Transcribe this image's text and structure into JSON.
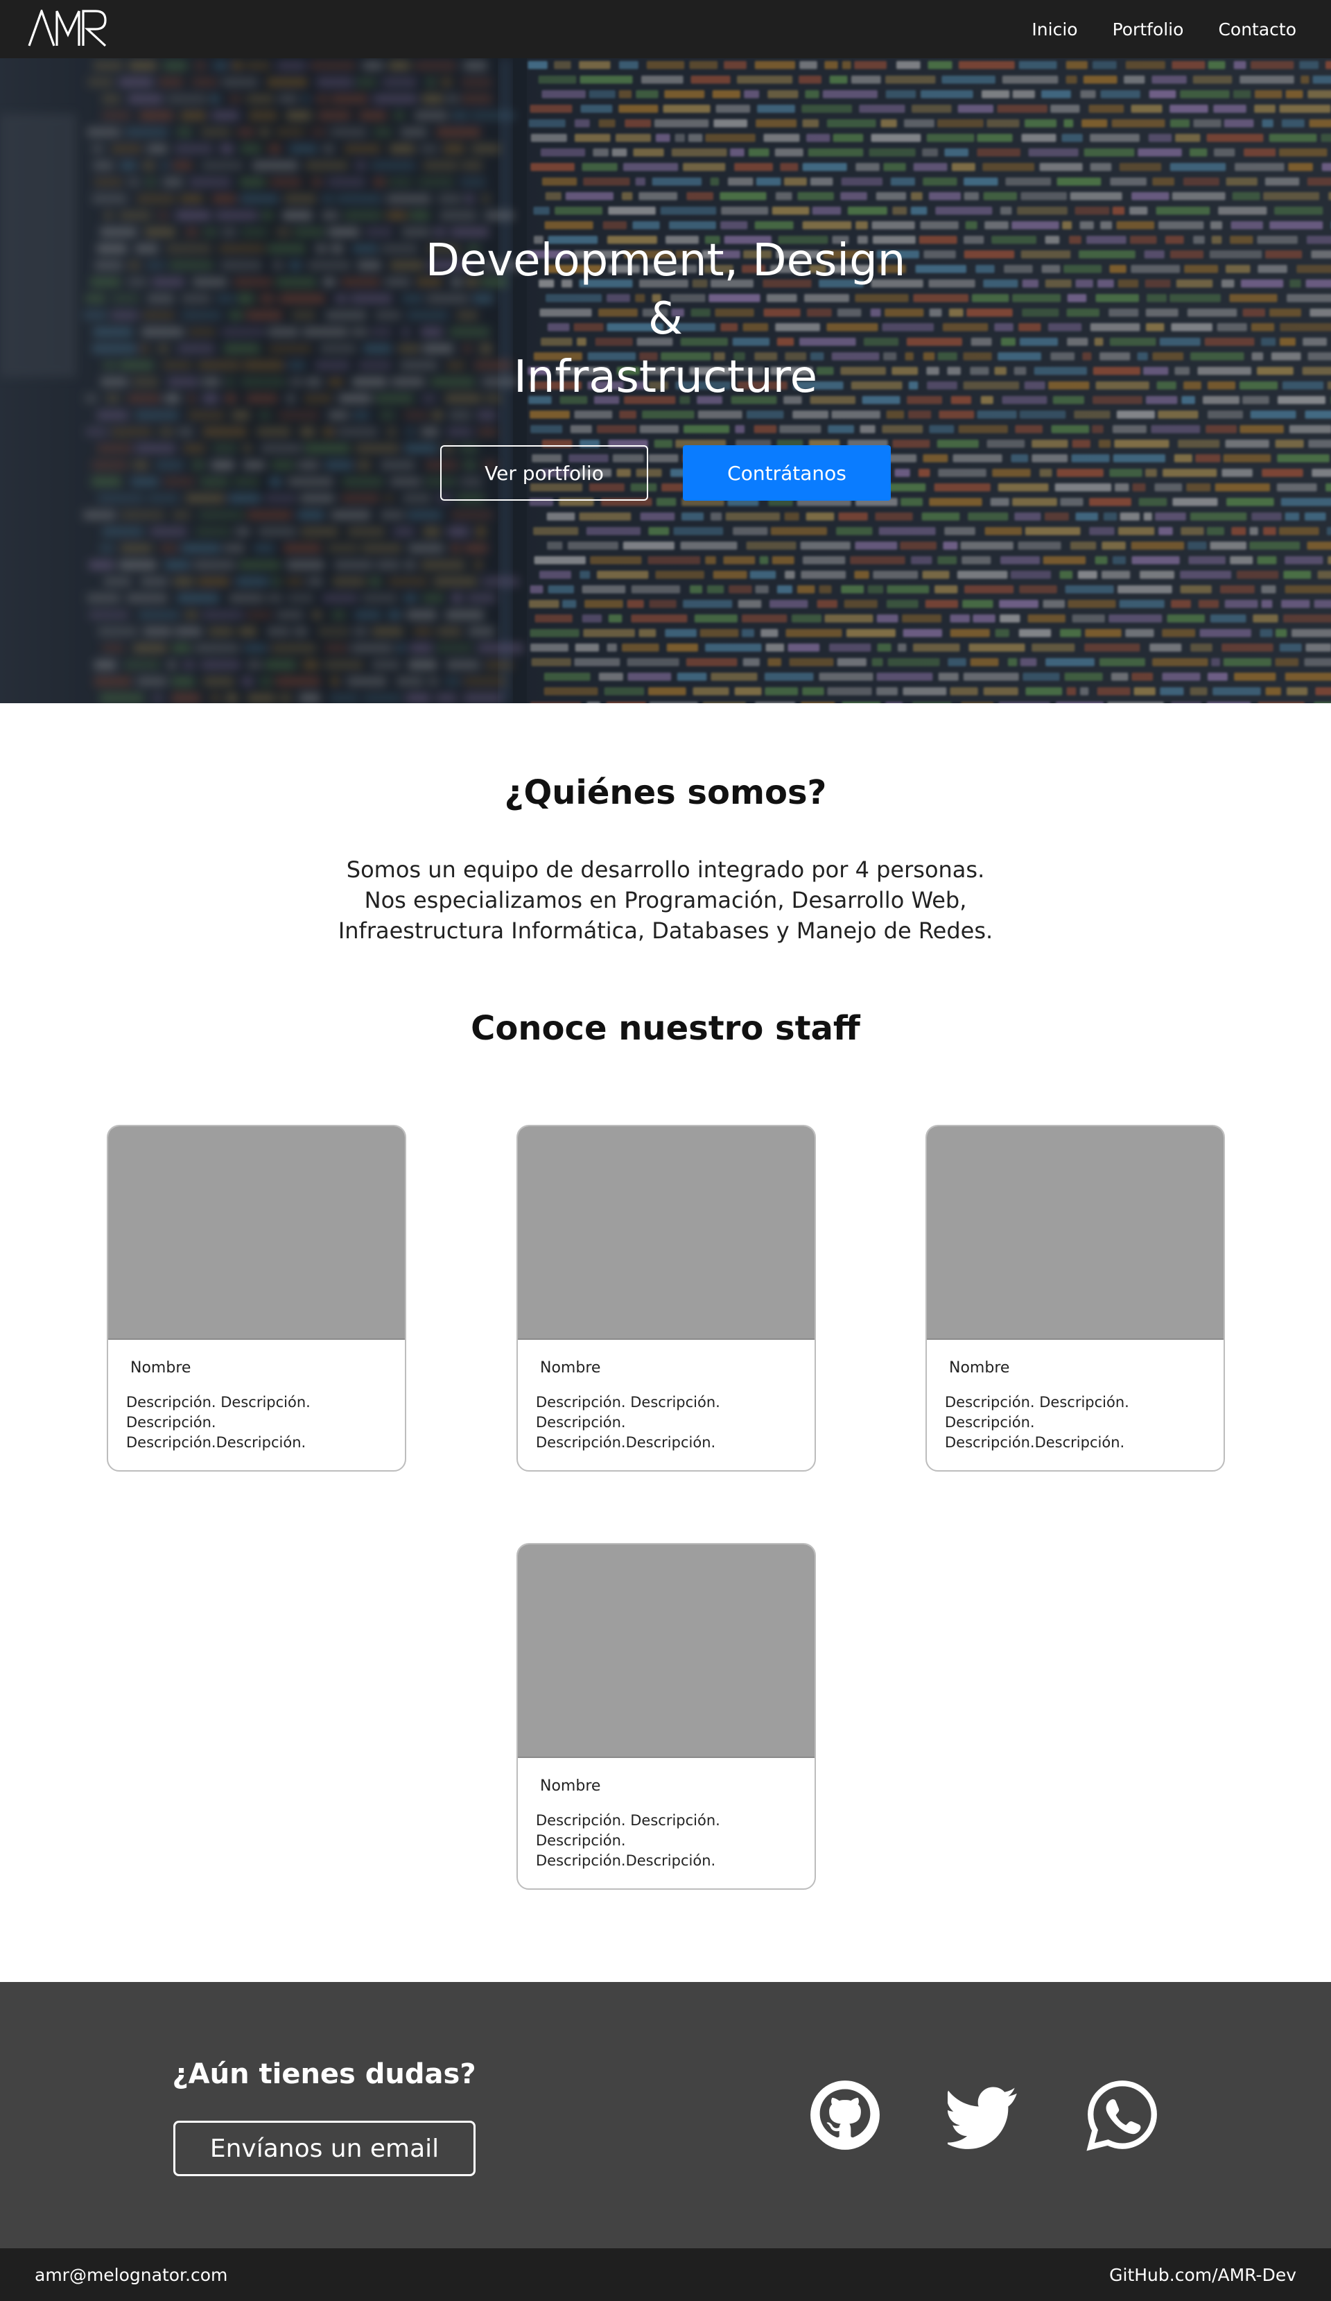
{
  "brand": {
    "logo_text": "AMR"
  },
  "nav": {
    "items": [
      "Inicio",
      "Portfolio",
      "Contacto"
    ]
  },
  "hero": {
    "title_lines": [
      "Development, Design",
      "&",
      "Infrastructure"
    ],
    "btn_portfolio": "Ver portfolio",
    "btn_hire": "Contrátanos"
  },
  "about": {
    "title": "¿Quiénes somos?",
    "lines": [
      "Somos un equipo de desarrollo integrado por 4 personas.",
      "Nos especializamos en Programación, Desarrollo Web,",
      "Infraestructura Informática, Databases y Manejo de Redes."
    ]
  },
  "staff": {
    "title": "Conoce nuestro staff",
    "members": [
      {
        "name": "Nombre",
        "desc": [
          "Descripción. Descripción.",
          "Descripción.",
          "Descripción.Descripción."
        ]
      },
      {
        "name": "Nombre",
        "desc": [
          "Descripción. Descripción.",
          "Descripción.",
          "Descripción.Descripción."
        ]
      },
      {
        "name": "Nombre",
        "desc": [
          "Descripción. Descripción.",
          "Descripción.",
          "Descripción.Descripción."
        ]
      },
      {
        "name": "Nombre",
        "desc": [
          "Descripción. Descripción.",
          "Descripción.",
          "Descripción.Descripción."
        ]
      }
    ]
  },
  "footer": {
    "title": "¿Aún tienes dudas?",
    "email_button": "Envíanos un email",
    "social_icons": [
      "github-icon",
      "twitter-icon",
      "whatsapp-icon"
    ]
  },
  "bottom": {
    "email": "amr@melognator.com",
    "github": "GitHub.com/AMR-Dev"
  },
  "colors": {
    "nav_bg": "#1f1f1f",
    "accent": "#0a7cff",
    "footer_bg": "#434343",
    "card_photo": "#9e9e9e"
  }
}
